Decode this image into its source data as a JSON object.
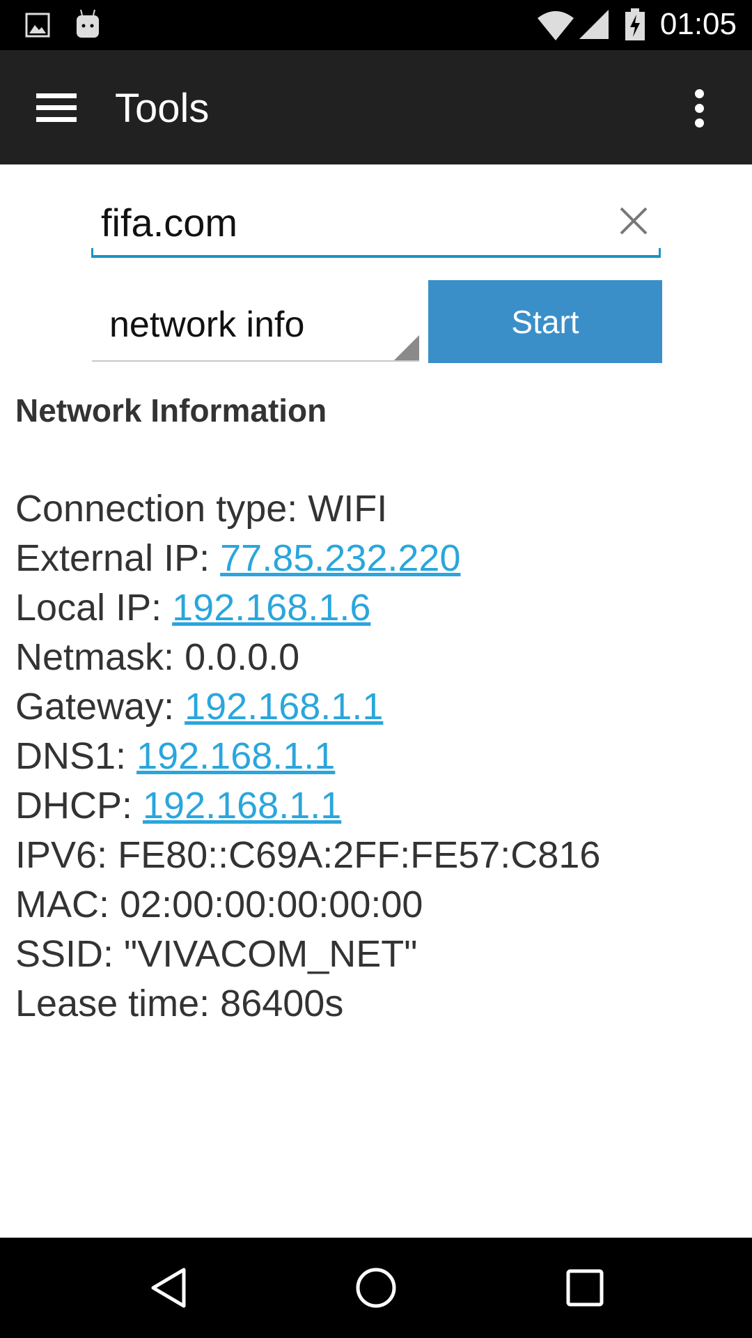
{
  "status_bar": {
    "time": "01:05",
    "icons": [
      "image-notification-icon",
      "android-debug-icon",
      "wifi-icon",
      "cell-signal-icon",
      "battery-charging-icon"
    ]
  },
  "toolbar": {
    "title": "Tools",
    "menu_icon": "hamburger-icon",
    "more_icon": "overflow-menu-icon"
  },
  "search": {
    "value": "fifa.com",
    "clear_icon": "close-icon"
  },
  "tool_select": {
    "value": "network info"
  },
  "start_button": {
    "label": "Start",
    "color": "#3a8fc9"
  },
  "result": {
    "title": "Network Information",
    "lines": [
      {
        "label": "Connection type: ",
        "value": "WIFI",
        "link": false
      },
      {
        "label": "External IP: ",
        "value": "77.85.232.220",
        "link": true
      },
      {
        "label": "Local IP: ",
        "value": "192.168.1.6",
        "link": true
      },
      {
        "label": "Netmask: ",
        "value": "0.0.0.0",
        "link": false
      },
      {
        "label": "Gateway: ",
        "value": "192.168.1.1",
        "link": true
      },
      {
        "label": "DNS1: ",
        "value": "192.168.1.1",
        "link": true
      },
      {
        "label": "DHCP: ",
        "value": "192.168.1.1",
        "link": true
      },
      {
        "label": "IPV6: ",
        "value": "FE80::C69A:2FF:FE57:C816",
        "link": false
      },
      {
        "label": "MAC: ",
        "value": "02:00:00:00:00:00",
        "link": false
      },
      {
        "label": "SSID: ",
        "value": "\"VIVACOM_NET\"",
        "link": false
      },
      {
        "label": "Lease time: ",
        "value": "86400s",
        "link": false
      }
    ],
    "link_color": "#2aa6dc"
  },
  "nav_bar": {
    "icons": [
      "back-icon",
      "home-icon",
      "recents-icon"
    ]
  }
}
